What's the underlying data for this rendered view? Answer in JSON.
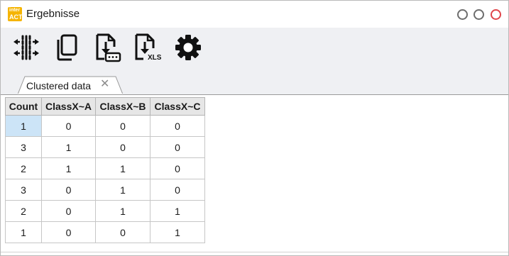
{
  "window": {
    "title": "Ergebnisse",
    "app_icon_text": [
      "inter",
      "ACT"
    ],
    "accent_close": "#e0454a"
  },
  "toolbar": {
    "buttons": [
      {
        "name": "adjust-columns-icon"
      },
      {
        "name": "copy-icon"
      },
      {
        "name": "export-download-icon"
      },
      {
        "name": "export-xls-icon",
        "badge": "XLS"
      },
      {
        "name": "settings-gear-icon"
      }
    ]
  },
  "tabs": [
    {
      "label": "Clustered data",
      "close": "✕"
    }
  ],
  "table": {
    "columns": [
      "Count",
      "ClassX~A",
      "ClassX~B",
      "ClassX~C"
    ],
    "rows": [
      [
        "1",
        "0",
        "0",
        "0"
      ],
      [
        "3",
        "1",
        "0",
        "0"
      ],
      [
        "2",
        "1",
        "1",
        "0"
      ],
      [
        "3",
        "0",
        "1",
        "0"
      ],
      [
        "2",
        "0",
        "1",
        "1"
      ],
      [
        "1",
        "0",
        "0",
        "1"
      ]
    ],
    "selected_cell_color": "#cce4f7"
  }
}
